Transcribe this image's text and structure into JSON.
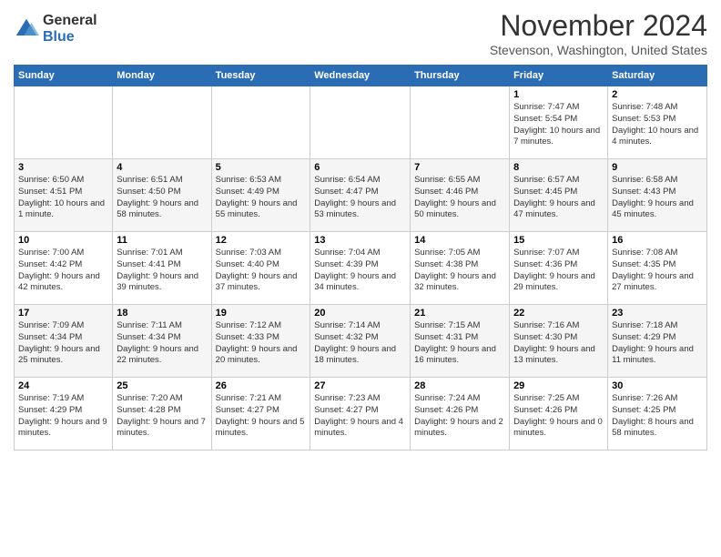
{
  "logo": {
    "general": "General",
    "blue": "Blue"
  },
  "header": {
    "month_title": "November 2024",
    "location": "Stevenson, Washington, United States"
  },
  "days_of_week": [
    "Sunday",
    "Monday",
    "Tuesday",
    "Wednesday",
    "Thursday",
    "Friday",
    "Saturday"
  ],
  "weeks": [
    [
      {
        "day": "",
        "info": ""
      },
      {
        "day": "",
        "info": ""
      },
      {
        "day": "",
        "info": ""
      },
      {
        "day": "",
        "info": ""
      },
      {
        "day": "",
        "info": ""
      },
      {
        "day": "1",
        "info": "Sunrise: 7:47 AM\nSunset: 5:54 PM\nDaylight: 10 hours and 7 minutes."
      },
      {
        "day": "2",
        "info": "Sunrise: 7:48 AM\nSunset: 5:53 PM\nDaylight: 10 hours and 4 minutes."
      }
    ],
    [
      {
        "day": "3",
        "info": "Sunrise: 6:50 AM\nSunset: 4:51 PM\nDaylight: 10 hours and 1 minute."
      },
      {
        "day": "4",
        "info": "Sunrise: 6:51 AM\nSunset: 4:50 PM\nDaylight: 9 hours and 58 minutes."
      },
      {
        "day": "5",
        "info": "Sunrise: 6:53 AM\nSunset: 4:49 PM\nDaylight: 9 hours and 55 minutes."
      },
      {
        "day": "6",
        "info": "Sunrise: 6:54 AM\nSunset: 4:47 PM\nDaylight: 9 hours and 53 minutes."
      },
      {
        "day": "7",
        "info": "Sunrise: 6:55 AM\nSunset: 4:46 PM\nDaylight: 9 hours and 50 minutes."
      },
      {
        "day": "8",
        "info": "Sunrise: 6:57 AM\nSunset: 4:45 PM\nDaylight: 9 hours and 47 minutes."
      },
      {
        "day": "9",
        "info": "Sunrise: 6:58 AM\nSunset: 4:43 PM\nDaylight: 9 hours and 45 minutes."
      }
    ],
    [
      {
        "day": "10",
        "info": "Sunrise: 7:00 AM\nSunset: 4:42 PM\nDaylight: 9 hours and 42 minutes."
      },
      {
        "day": "11",
        "info": "Sunrise: 7:01 AM\nSunset: 4:41 PM\nDaylight: 9 hours and 39 minutes."
      },
      {
        "day": "12",
        "info": "Sunrise: 7:03 AM\nSunset: 4:40 PM\nDaylight: 9 hours and 37 minutes."
      },
      {
        "day": "13",
        "info": "Sunrise: 7:04 AM\nSunset: 4:39 PM\nDaylight: 9 hours and 34 minutes."
      },
      {
        "day": "14",
        "info": "Sunrise: 7:05 AM\nSunset: 4:38 PM\nDaylight: 9 hours and 32 minutes."
      },
      {
        "day": "15",
        "info": "Sunrise: 7:07 AM\nSunset: 4:36 PM\nDaylight: 9 hours and 29 minutes."
      },
      {
        "day": "16",
        "info": "Sunrise: 7:08 AM\nSunset: 4:35 PM\nDaylight: 9 hours and 27 minutes."
      }
    ],
    [
      {
        "day": "17",
        "info": "Sunrise: 7:09 AM\nSunset: 4:34 PM\nDaylight: 9 hours and 25 minutes."
      },
      {
        "day": "18",
        "info": "Sunrise: 7:11 AM\nSunset: 4:34 PM\nDaylight: 9 hours and 22 minutes."
      },
      {
        "day": "19",
        "info": "Sunrise: 7:12 AM\nSunset: 4:33 PM\nDaylight: 9 hours and 20 minutes."
      },
      {
        "day": "20",
        "info": "Sunrise: 7:14 AM\nSunset: 4:32 PM\nDaylight: 9 hours and 18 minutes."
      },
      {
        "day": "21",
        "info": "Sunrise: 7:15 AM\nSunset: 4:31 PM\nDaylight: 9 hours and 16 minutes."
      },
      {
        "day": "22",
        "info": "Sunrise: 7:16 AM\nSunset: 4:30 PM\nDaylight: 9 hours and 13 minutes."
      },
      {
        "day": "23",
        "info": "Sunrise: 7:18 AM\nSunset: 4:29 PM\nDaylight: 9 hours and 11 minutes."
      }
    ],
    [
      {
        "day": "24",
        "info": "Sunrise: 7:19 AM\nSunset: 4:29 PM\nDaylight: 9 hours and 9 minutes."
      },
      {
        "day": "25",
        "info": "Sunrise: 7:20 AM\nSunset: 4:28 PM\nDaylight: 9 hours and 7 minutes."
      },
      {
        "day": "26",
        "info": "Sunrise: 7:21 AM\nSunset: 4:27 PM\nDaylight: 9 hours and 5 minutes."
      },
      {
        "day": "27",
        "info": "Sunrise: 7:23 AM\nSunset: 4:27 PM\nDaylight: 9 hours and 4 minutes."
      },
      {
        "day": "28",
        "info": "Sunrise: 7:24 AM\nSunset: 4:26 PM\nDaylight: 9 hours and 2 minutes."
      },
      {
        "day": "29",
        "info": "Sunrise: 7:25 AM\nSunset: 4:26 PM\nDaylight: 9 hours and 0 minutes."
      },
      {
        "day": "30",
        "info": "Sunrise: 7:26 AM\nSunset: 4:25 PM\nDaylight: 8 hours and 58 minutes."
      }
    ]
  ]
}
